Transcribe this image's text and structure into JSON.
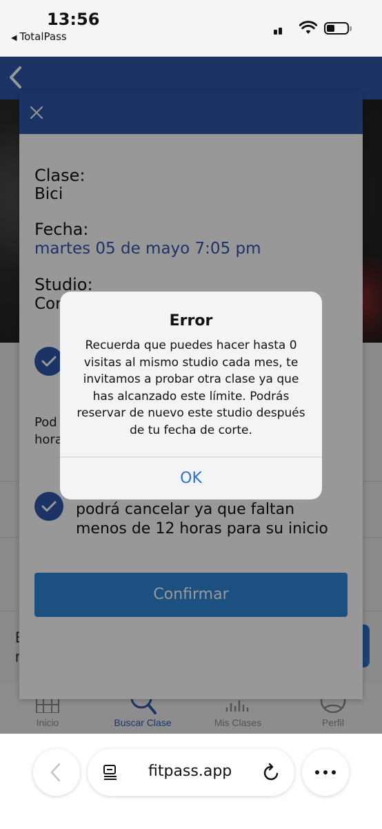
{
  "status_bar": {
    "time": "13:56",
    "back_app": "TotalPass"
  },
  "background": {
    "bg_text_1": "E",
    "bg_text_2": "r",
    "tabs": [
      {
        "label": "Inicio",
        "icon": "grid-icon"
      },
      {
        "label": "Buscar Clase",
        "icon": "search-icon",
        "active": true
      },
      {
        "label": "Mis Clases",
        "icon": "audio-wave-icon"
      },
      {
        "label": "Perfil",
        "icon": "person-icon"
      }
    ]
  },
  "sheet": {
    "clase_label": "Clase:",
    "clase_value": "Bici",
    "fecha_label": "Fecha:",
    "fecha_value": "martes 05 de mayo 7:05 pm",
    "studio_label": "Studio:",
    "studio_value_partial": "Cor",
    "text_fragment_1": "Pod",
    "text_fragment_2": "hora",
    "cancel_notice_line1": "podrá cancelar ya que faltan",
    "cancel_notice_line2": "menos de 12 horas para su inicio",
    "confirm_label": "Confirmar"
  },
  "alert": {
    "title": "Error",
    "message": "Recuerda que puedes hacer hasta 0 visitas al mismo studio cada mes, te invitamos a probar otra clase ya que has alcanzado este límite. Podrás reservar de nuevo este studio después de tu fecha de corte.",
    "ok_label": "OK"
  },
  "browser": {
    "url": "fitpass.app"
  },
  "colors": {
    "brand_blue": "#2d56a8",
    "confirm_blue": "#2f86d6",
    "link_blue": "#2d6fd8"
  }
}
